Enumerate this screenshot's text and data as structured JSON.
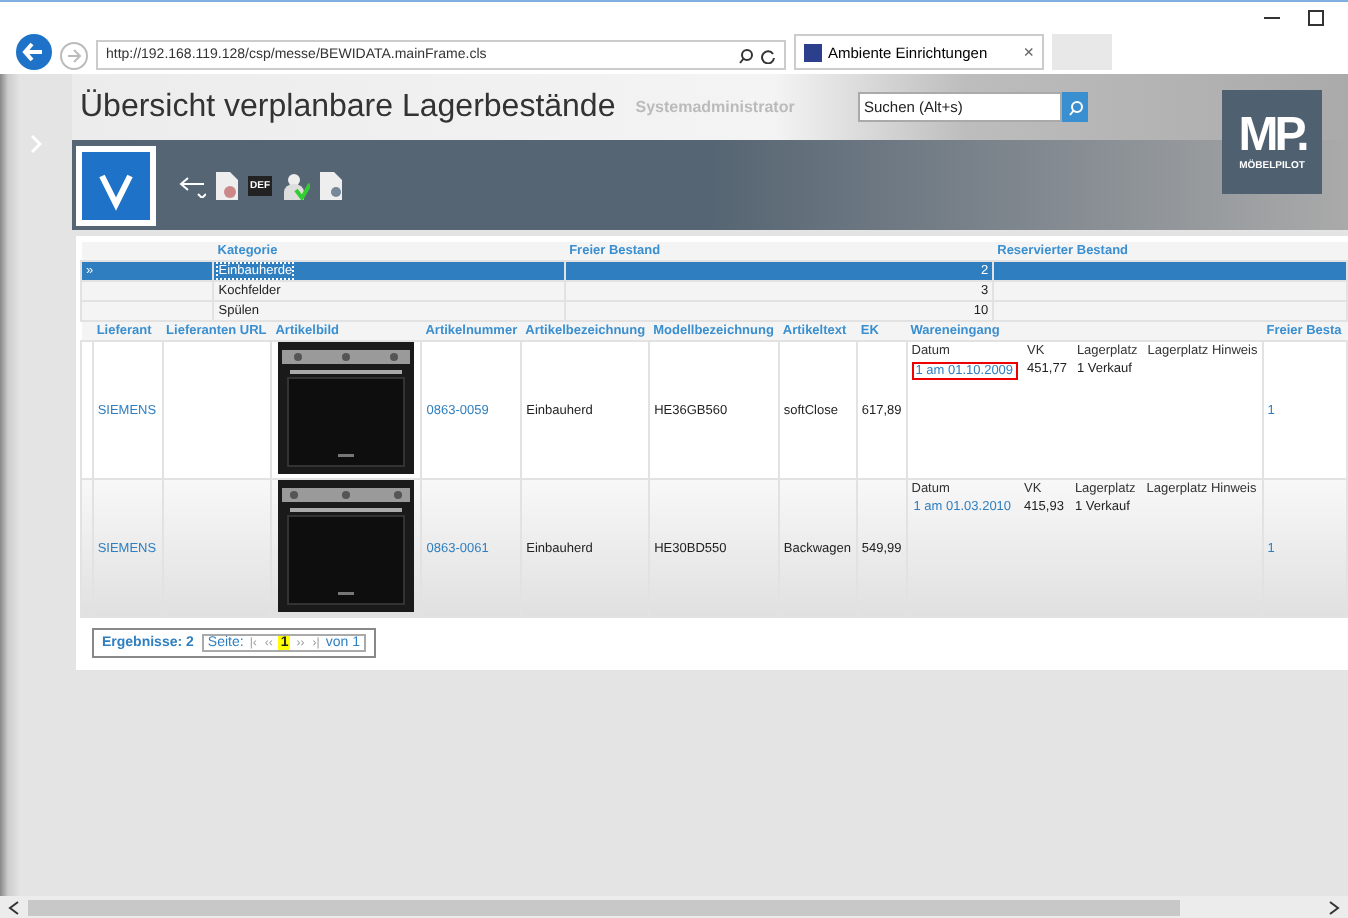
{
  "browser": {
    "url": "http://192.168.119.128/csp/messe/BEWIDATA.mainFrame.cls",
    "tab_title": "Ambiente Einrichtungen",
    "tab_close": "×"
  },
  "app": {
    "title": "Übersicht verplanbare Lagerbestände",
    "user": "Systemadministrator",
    "search": {
      "placeholder": "Suchen (Alt+s)"
    },
    "logo": {
      "mark": "MP.",
      "name": "MÖBELPILOT"
    },
    "toolbar": {
      "def_label": "DEF"
    }
  },
  "categories": {
    "columns": [
      "Kategorie",
      "Freier Bestand",
      "Reservierter Bestand"
    ],
    "rows": [
      {
        "marker": "»",
        "name": "Einbauherde",
        "free": "2",
        "reserved": "",
        "selected": true
      },
      {
        "marker": "",
        "name": "Kochfelder",
        "free": "3",
        "reserved": "",
        "selected": false
      },
      {
        "marker": "",
        "name": "Spülen",
        "free": "10",
        "reserved": "",
        "selected": false
      }
    ]
  },
  "articles": {
    "columns": [
      "Lieferant",
      "Lieferanten URL",
      "Artikelbild",
      "Artikelnummer",
      "Artikelbezeichnung",
      "Modellbezeichnung",
      "Artikeltext",
      "EK",
      "Wareneingang",
      "Freier Besta"
    ],
    "rows": [
      {
        "supplier": "SIEMENS",
        "number": "0863-0059",
        "designation": "Einbauherd",
        "model": "HE36GB560",
        "text": "softClose",
        "ek": "617,89",
        "receipt_columns": [
          "Datum",
          "VK",
          "Lagerplatz",
          "Lagerplatz Hinweis"
        ],
        "receipts": [
          {
            "date": "1 am 01.10.2009",
            "vk": "451,77",
            "location": "1 Verkauf",
            "highlighted": true
          }
        ],
        "free": "1"
      },
      {
        "supplier": "SIEMENS",
        "number": "0863-0061",
        "designation": "Einbauherd",
        "model": "HE30BD550",
        "text": "Backwagen",
        "ek": "549,99",
        "receipt_columns": [
          "Datum",
          "VK",
          "Lagerplatz",
          "Lagerplatz Hinweis"
        ],
        "receipts": [
          {
            "date": "1 am 01.03.2010",
            "vk": "415,93",
            "location": "1 Verkauf",
            "highlighted": false
          }
        ],
        "free": "1"
      }
    ]
  },
  "pager": {
    "results": "Ergebnisse: 2",
    "page_label": "Seite:",
    "first": "|‹",
    "prev": "‹‹",
    "current": "1",
    "next": "››",
    "last": "›|",
    "total": "von 1"
  }
}
